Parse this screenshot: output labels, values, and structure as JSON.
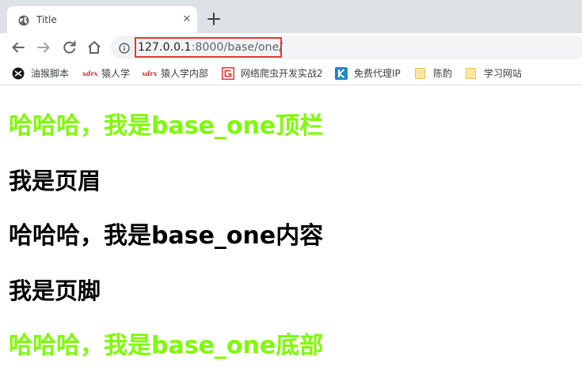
{
  "tab": {
    "title": "Title",
    "close_glyph": "✕",
    "favicon": "globe-icon"
  },
  "toolbar": {
    "url_host": "127.0.0.1",
    "url_path": ":8000/base/one/"
  },
  "bookmarks": [
    {
      "label": "油猴脚本",
      "icon": "tampermonkey-icon"
    },
    {
      "label": "猿人学",
      "icon_text": "xdrx"
    },
    {
      "label": "猿人学内部",
      "icon_text": "xdrx"
    },
    {
      "label": "网络爬虫开发实战2",
      "icon": "g-logo-icon"
    },
    {
      "label": "免费代理IP",
      "icon": "k-logo-icon"
    },
    {
      "label": "陈酌",
      "icon": "folder-icon"
    },
    {
      "label": "学习网站",
      "icon": "folder-icon"
    }
  ],
  "content": {
    "top_bar": "哈哈哈，我是base_one顶栏",
    "header": "我是页眉",
    "main": "哈哈哈，我是base_one内容",
    "footer": "我是页脚",
    "bottom": "哈哈哈，我是base_one底部"
  },
  "colors": {
    "highlight_green": "#7cfc00",
    "url_outline_red": "#e53935"
  }
}
